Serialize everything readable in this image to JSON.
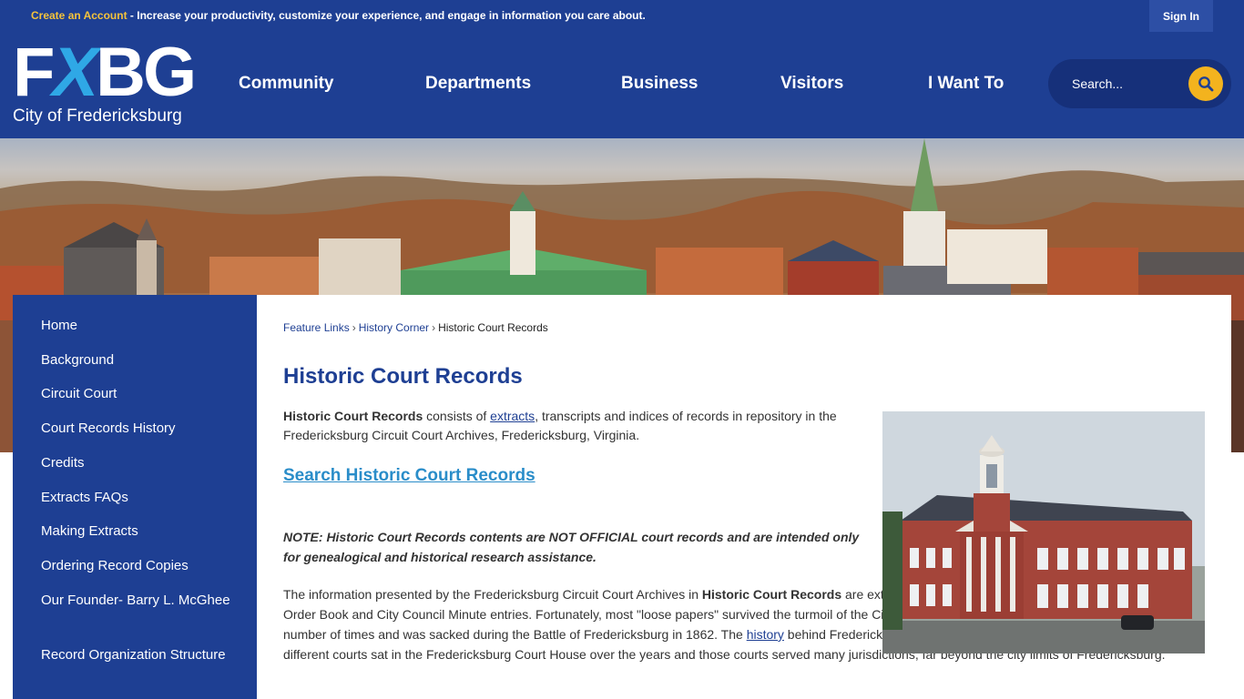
{
  "topbar": {
    "create_account": "Create an Account",
    "promo_text": " - Increase your productivity, customize your experience, and engage in information you care about.",
    "sign_in": "Sign In"
  },
  "header": {
    "logo_letters": [
      "F",
      "X",
      "B",
      "G"
    ],
    "logo_city": "City of Fredericksburg",
    "nav": [
      "Community",
      "Departments",
      "Business",
      "Visitors",
      "I Want To"
    ],
    "search_placeholder": "Search..."
  },
  "sidebar": {
    "items": [
      "Home",
      "Background",
      "Circuit Court",
      "Court Records History",
      "Credits",
      "Extracts FAQs",
      "Making Extracts",
      "Ordering Record Copies",
      "Our Founder- Barry L. McGhee",
      "Record Organization Structure"
    ]
  },
  "breadcrumb": {
    "items": [
      "Feature Links",
      "History Corner",
      "Historic Court Records"
    ],
    "separator": "›"
  },
  "main": {
    "title": "Historic Court Records",
    "p1_bold": "Historic Court Records",
    "p1_a": " consists of ",
    "p1_link": "extracts",
    "p1_b": ", transcripts and indices of records in repository in the Fredericksburg Circuit Court Archives, Fredericksburg, Virginia.",
    "search_link": "Search Historic Court Records",
    "note": "NOTE: Historic Court Records contents are NOT OFFICIAL court records and are intended only for genealogical and historical research assistance.",
    "p3_a": "The information presented by the Fredericksburg Circuit Court Archives in ",
    "p3_bold": "Historic Court Records",
    "p3_b": " are extracts of \"loose papers\" - the paper trail behind Court Order Book and City Council Minute entries. Fortunately, most \"loose papers\" survived the turmoil of the Civil War even though Fredericksburg changed hands a number of times and was sacked during the Battle of Fredericksburg in 1862. The ",
    "p3_link": "history",
    "p3_c": " behind Fredericksburg's \"loose papers\" is complicated. A number of different courts sat in the Fredericksburg Court House over the years and those courts served many jurisdictions, far beyond the city limits of Fredericksburg."
  },
  "colors": {
    "brand_blue": "#1e3f93",
    "accent_yellow": "#f3b31e",
    "logo_x_blue": "#2fa8e6",
    "link_blue": "#2a8dc9"
  },
  "icons": {
    "search": "magnifier-icon"
  }
}
